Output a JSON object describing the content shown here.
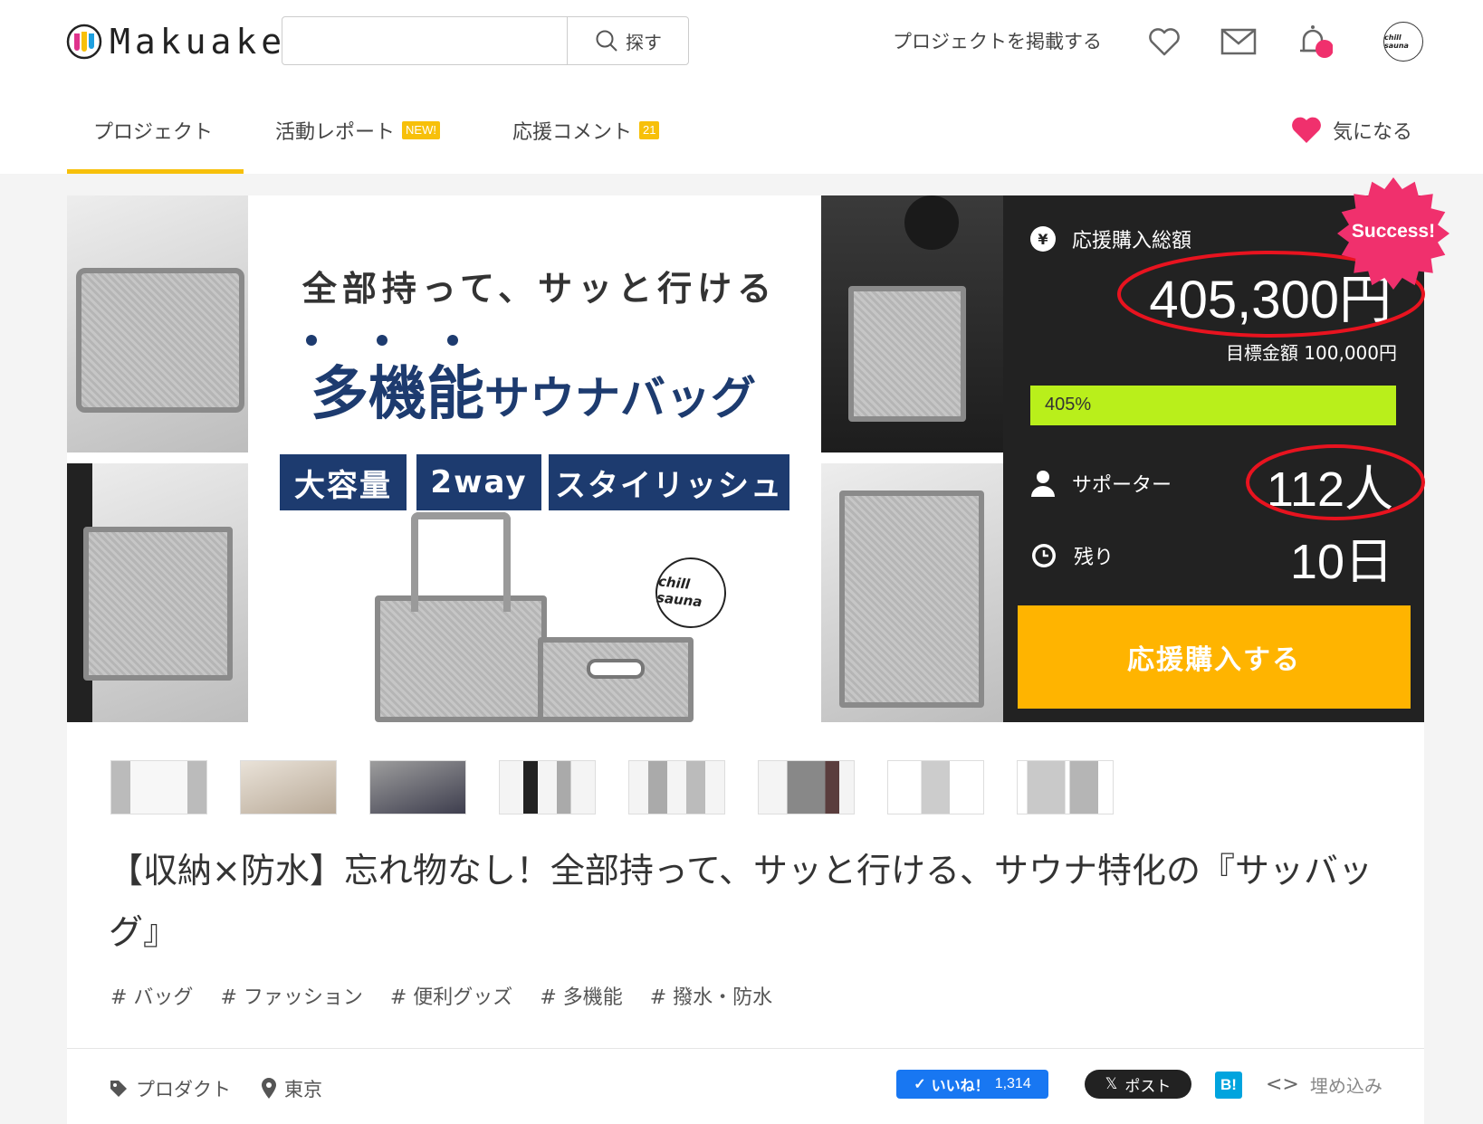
{
  "header": {
    "logo_text": "Makuake",
    "search": {
      "placeholder": "",
      "button_label": "探す"
    },
    "post_project_link": "プロジェクトを掲載する",
    "avatar_text": "chill sauna",
    "icons": [
      "heart-icon",
      "mail-icon",
      "bell-icon",
      "avatar"
    ]
  },
  "tabs": [
    {
      "label": "プロジェクト",
      "active": true
    },
    {
      "label": "活動レポート",
      "badge": "NEW!"
    },
    {
      "label": "応援コメント",
      "badge": "21"
    }
  ],
  "favorite_label": "気になる",
  "hero": {
    "headline": "全部持って、サッと行ける",
    "title_main": "多機能",
    "title_sub": "サウナバッグ",
    "features": [
      "大容量",
      "2way",
      "スタイリッシュ"
    ],
    "brand": "chill sauna"
  },
  "panel": {
    "success_badge": "Success!",
    "total_label": "応援購入総額",
    "total_amount": "405,300円",
    "goal_text": "目標金額 100,000円",
    "progress_percent": 405,
    "progress_label": "405%",
    "supporters_label": "サポーター",
    "supporters_value": "112人",
    "remaining_label": "残り",
    "remaining_value": "10日",
    "cta_label": "応援購入する",
    "accent_color": "#ffb400",
    "progress_color": "#b9ef1b"
  },
  "thumbnails_count": 8,
  "project_title": "【収納×防水】忘れ物なし！全部持って、サッと行ける、サウナ特化の『サッバッグ』",
  "tags": [
    "# バッグ",
    "# ファッション",
    "# 便利グッズ",
    "# 多機能",
    "# 撥水・防水"
  ],
  "footer": {
    "category": "プロダクト",
    "location": "東京",
    "like_label": "いいね！",
    "like_count": "1,314",
    "post_label": "ポスト",
    "hatena_label": "B!",
    "embed_label": "埋め込み"
  }
}
